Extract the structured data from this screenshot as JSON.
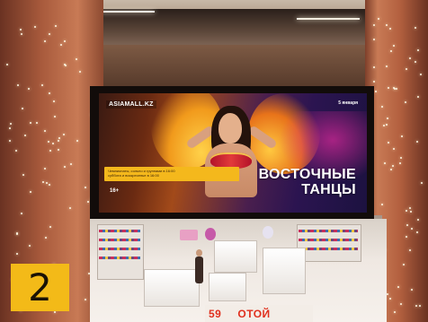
{
  "billboard": {
    "logo_text": "ASIAMALL.KZ",
    "date_text": "5 января",
    "info_lines": [
      "Чемпионаты, сольно и группами в 16:00",
      "суббота и воскресенье в 16:00"
    ],
    "age_rating": "16+",
    "title_line1": "ВОСТОЧНЫЕ",
    "title_line2": "ТАНЦЫ"
  },
  "storefront": {
    "sign_part1": "59",
    "sign_part2": "ОТОЙ"
  },
  "badge": {
    "number": "2",
    "color": "#f3ba18"
  },
  "colors": {
    "wall": "#b3603f",
    "billboard_accent": "#f4b81c",
    "sign_red": "#e0301e"
  }
}
